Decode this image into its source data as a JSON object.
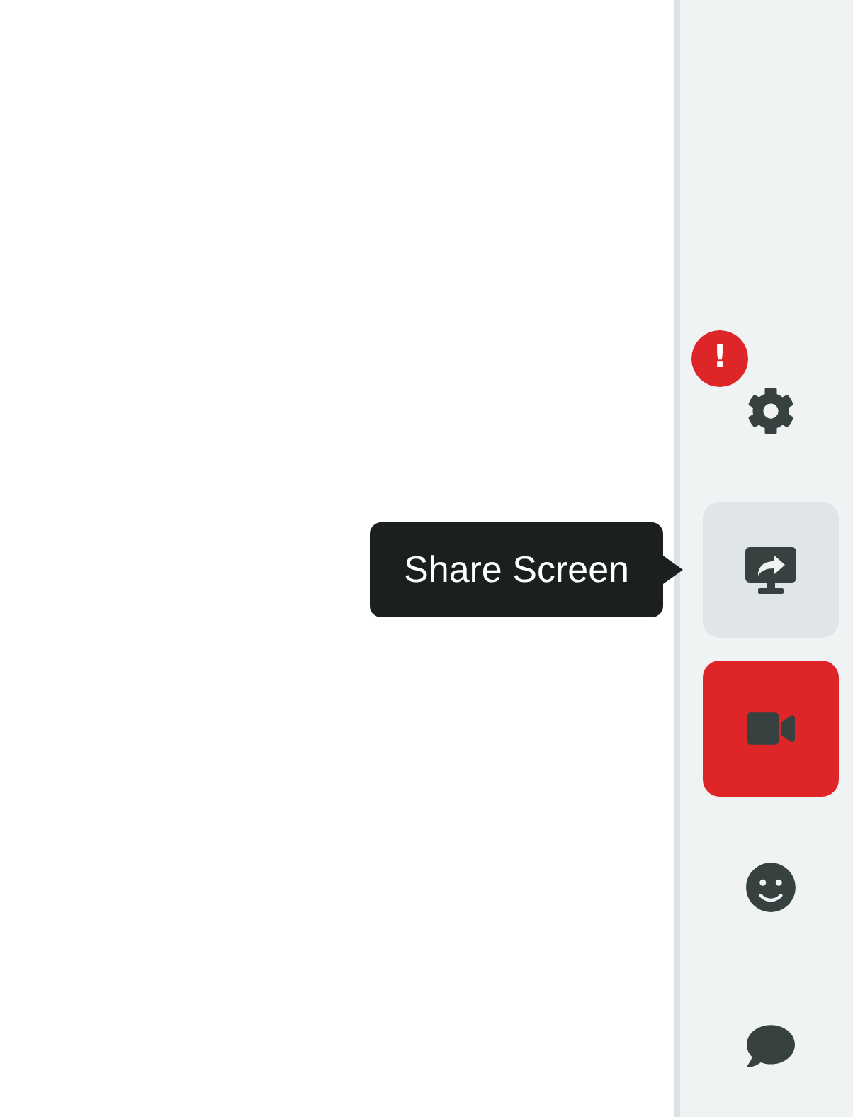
{
  "sidebar": {
    "buttons": [
      {
        "kind": "settings",
        "hovered": false,
        "alert": false,
        "badge": "!"
      },
      {
        "kind": "share_screen",
        "hovered": true,
        "alert": false,
        "tooltip": "Share Screen"
      },
      {
        "kind": "camera",
        "hovered": false,
        "alert": true
      },
      {
        "kind": "reactions",
        "hovered": false,
        "alert": false
      },
      {
        "kind": "chat",
        "hovered": false,
        "alert": false
      }
    ]
  }
}
